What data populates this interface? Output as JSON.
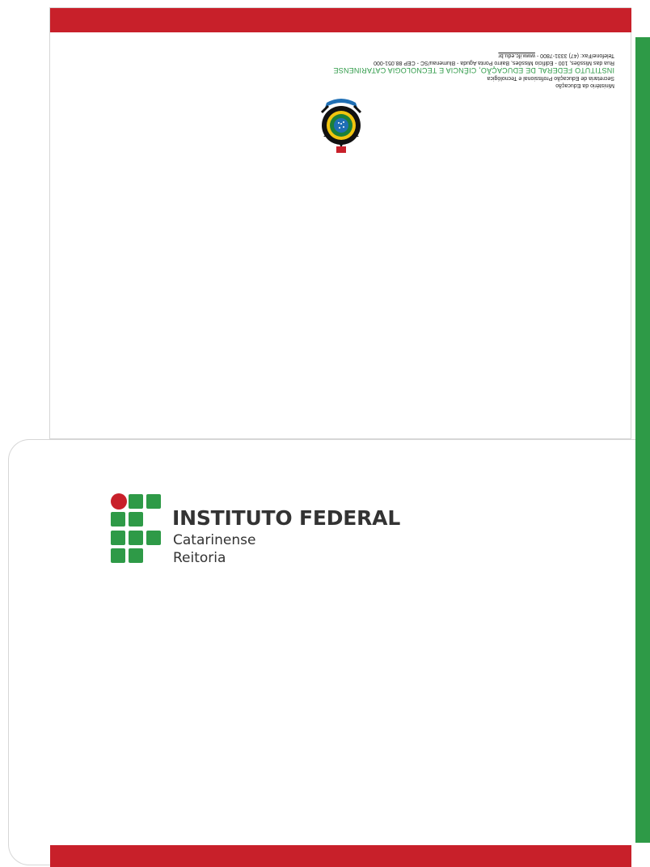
{
  "header": {
    "ministry": "Ministério da Educação",
    "secretariat": "Secretaria de Educação Profissional e Tecnológica",
    "institute_full": "INSTITUTO FEDERAL DE EDUCAÇÃO, CIÊNCIA E TECNOLOGIA CATARINENSE",
    "address": "Rua das Missões, 100 - Edifício Missões, Bairro Ponta Aguda - Blumenau/SC - CEP 88.051-000",
    "phone": "Telefone/Fax: (47) 3331-7800 - ",
    "website": "www.ifc.edu.br"
  },
  "logo": {
    "title": "INSTITUTO FEDERAL",
    "subtitle": "Catarinense",
    "unit": "Reitoria"
  },
  "colors": {
    "red": "#c8202a",
    "green": "#2e9a47",
    "text": "#333333"
  }
}
